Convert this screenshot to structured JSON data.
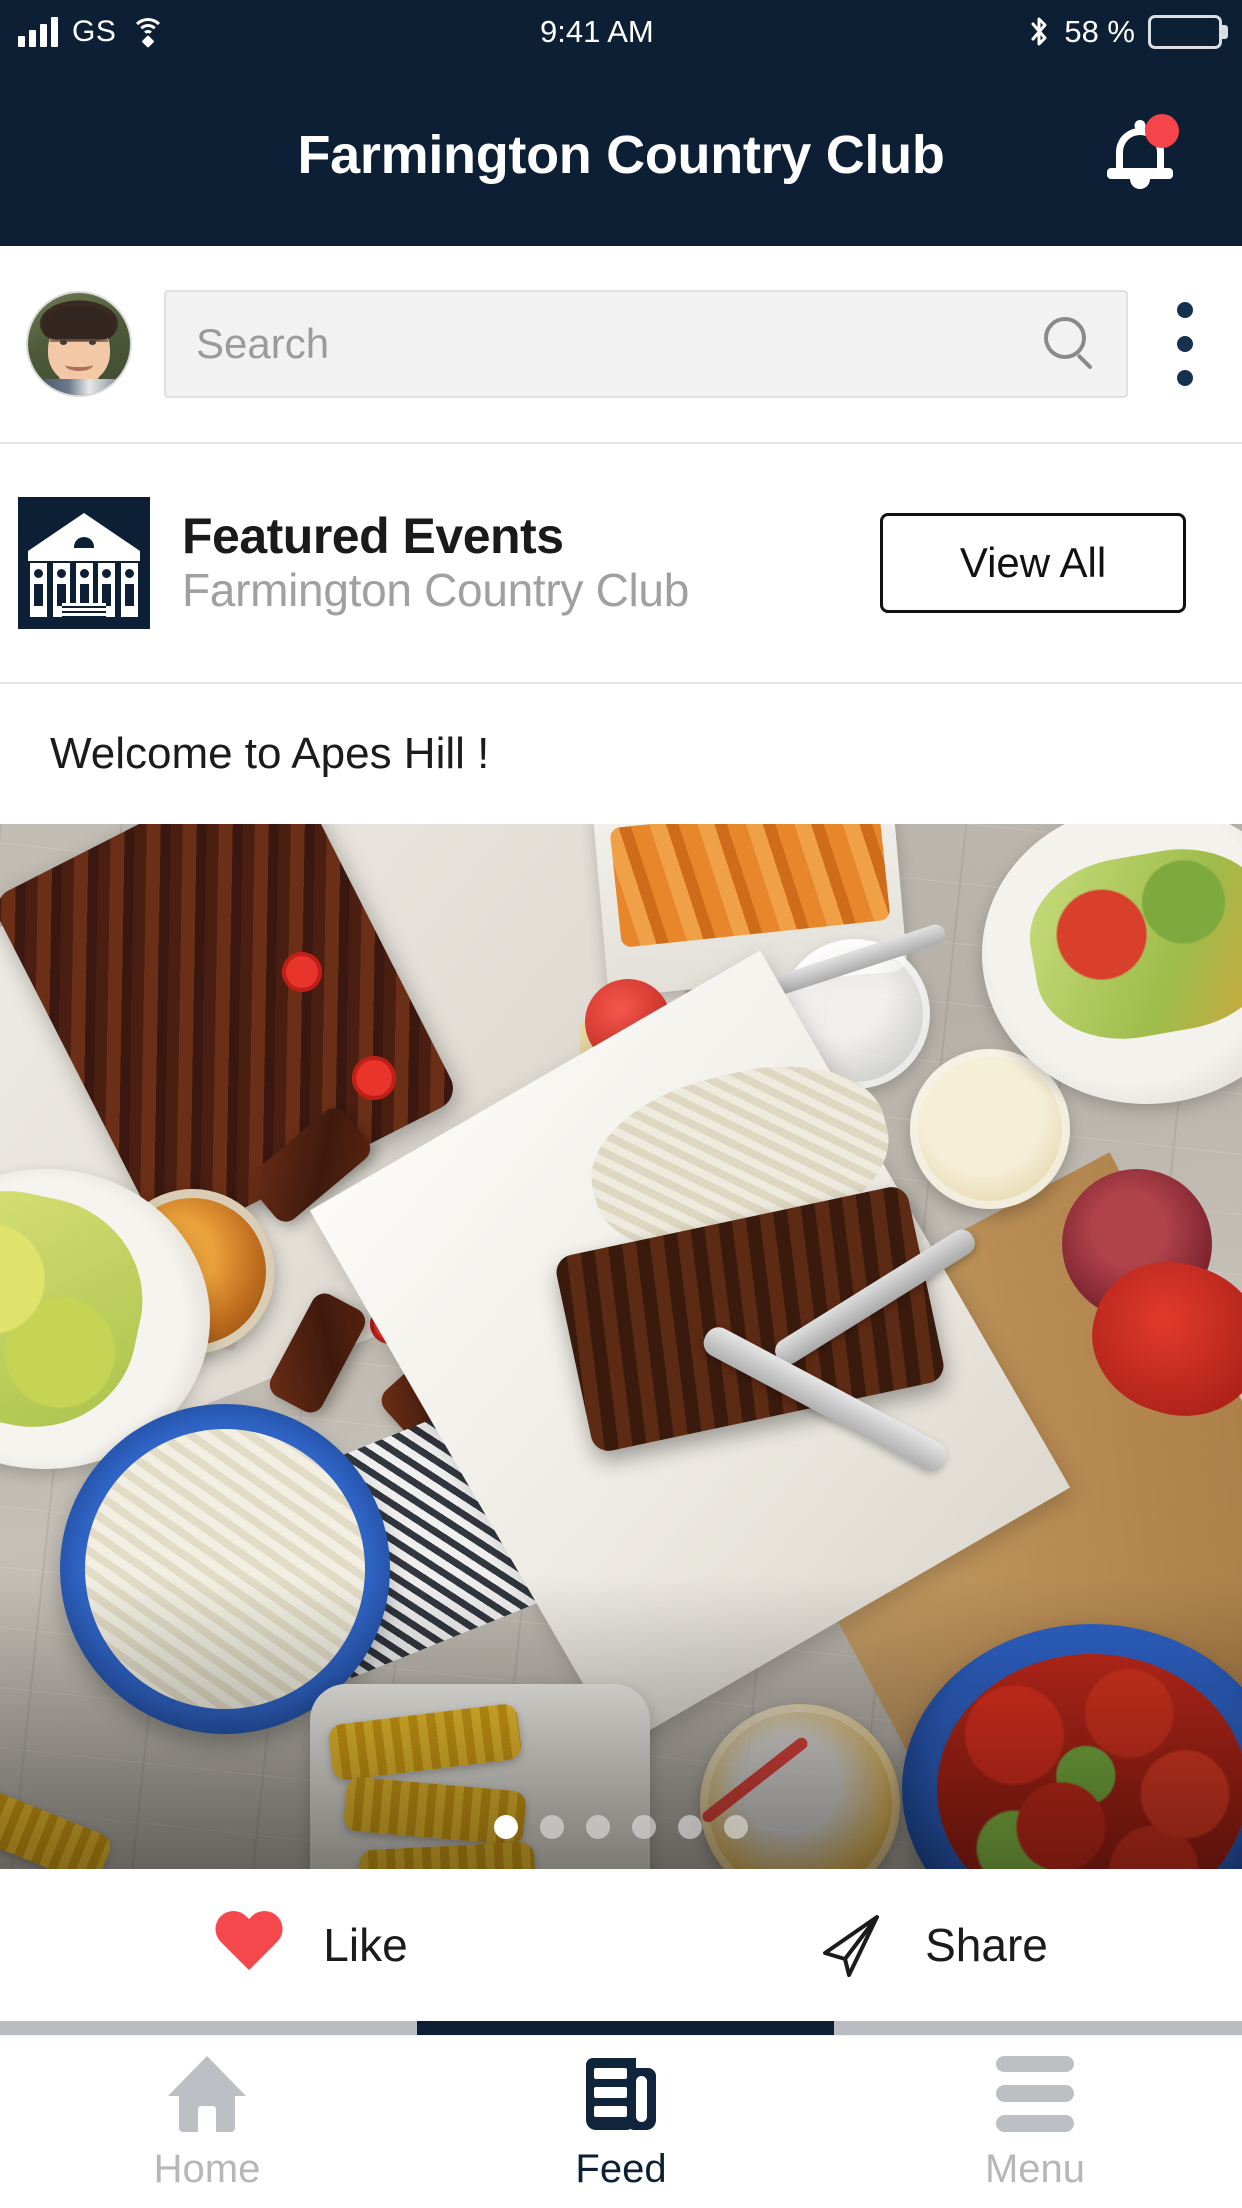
{
  "status_bar": {
    "carrier": "GS",
    "time": "9:41 AM",
    "battery_percent": "58 %",
    "battery_level": 58,
    "icons": [
      "signal-bars-icon",
      "wifi-icon",
      "bluetooth-icon",
      "battery-icon"
    ]
  },
  "header": {
    "title": "Farmington Country Club",
    "background_color": "#0d1f35",
    "notification_icon": "bell-icon",
    "notification_badge_color": "#f5444a",
    "has_notification": true
  },
  "search_row": {
    "avatar_alt": "user-avatar",
    "search_placeholder": "Search",
    "search_value": "",
    "search_icon": "search-icon",
    "overflow_icon": "more-vertical-icon"
  },
  "featured": {
    "logo_alt": "farmington-country-club-crest",
    "title": "Featured Events",
    "subtitle": "Farmington Country Club",
    "view_all_label": "View All"
  },
  "post": {
    "caption": "Welcome to Apes Hill !",
    "image_alt": "bbq-table-spread-photo",
    "carousel": {
      "total": 6,
      "active_index": 0
    }
  },
  "actions": {
    "like_label": "Like",
    "like_icon": "heart-icon",
    "like_color": "#f5484c",
    "share_label": "Share",
    "share_icon": "send-icon"
  },
  "bottom_nav": {
    "active": "Feed",
    "items": [
      {
        "label": "Home",
        "icon": "home-icon",
        "active": false
      },
      {
        "label": "Feed",
        "icon": "newspaper-icon",
        "active": true
      },
      {
        "label": "Menu",
        "icon": "hamburger-menu-icon",
        "active": false
      }
    ]
  },
  "colors": {
    "brand_navy": "#0d1f35",
    "accent_red": "#f5444a",
    "muted_gray": "#a0a0a0",
    "inactive_nav": "#b7b7b7"
  }
}
